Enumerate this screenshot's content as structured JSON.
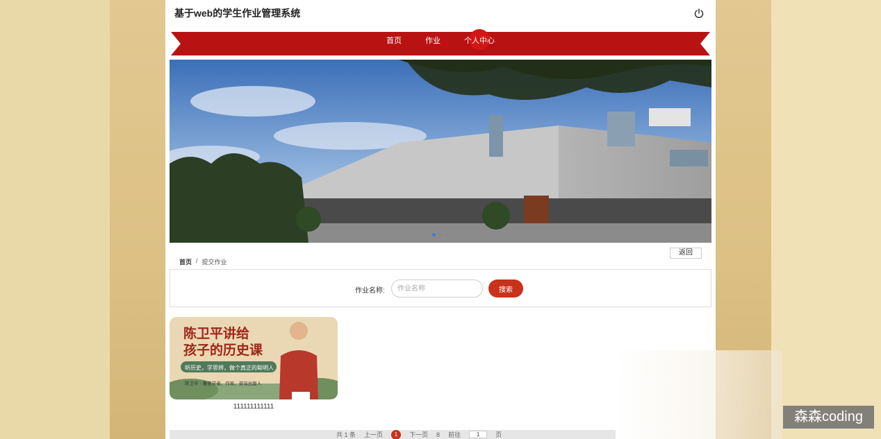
{
  "header": {
    "site_title": "基于web的学生作业管理系统",
    "power_icon": "power-icon"
  },
  "nav": {
    "items": [
      {
        "label": "首页"
      },
      {
        "label": "作业"
      },
      {
        "label": "个人中心"
      }
    ],
    "active_index": 2,
    "ribbon_color": "#b81212"
  },
  "banner": {
    "carousel_dot_count": 3,
    "active_dot": 0
  },
  "breadcrumb": {
    "home": "首页",
    "separator": "/",
    "current": "提交作业"
  },
  "back_button": "返回",
  "search": {
    "label": "作业名称:",
    "placeholder": "作业名称",
    "value": "",
    "button": "搜索"
  },
  "cards": [
    {
      "title": "111111111111",
      "image_text": {
        "line1": "陈卫平讲给",
        "line2": "孩子的历史课",
        "tagline": "听历史，学思辨，做个真正的聪明人",
        "author": "陈卫平 · 著名学者、作家、资深出版人"
      }
    }
  ],
  "pager": {
    "total": "共 1 条",
    "prev": "上一页",
    "current": "1",
    "next": "下一页",
    "page_size": "8",
    "goto_label": "前往",
    "goto_value": "1",
    "page_suffix": "页"
  },
  "watermark": "森森coding",
  "colors": {
    "accent": "#c8311a",
    "ribbon": "#b81212"
  }
}
